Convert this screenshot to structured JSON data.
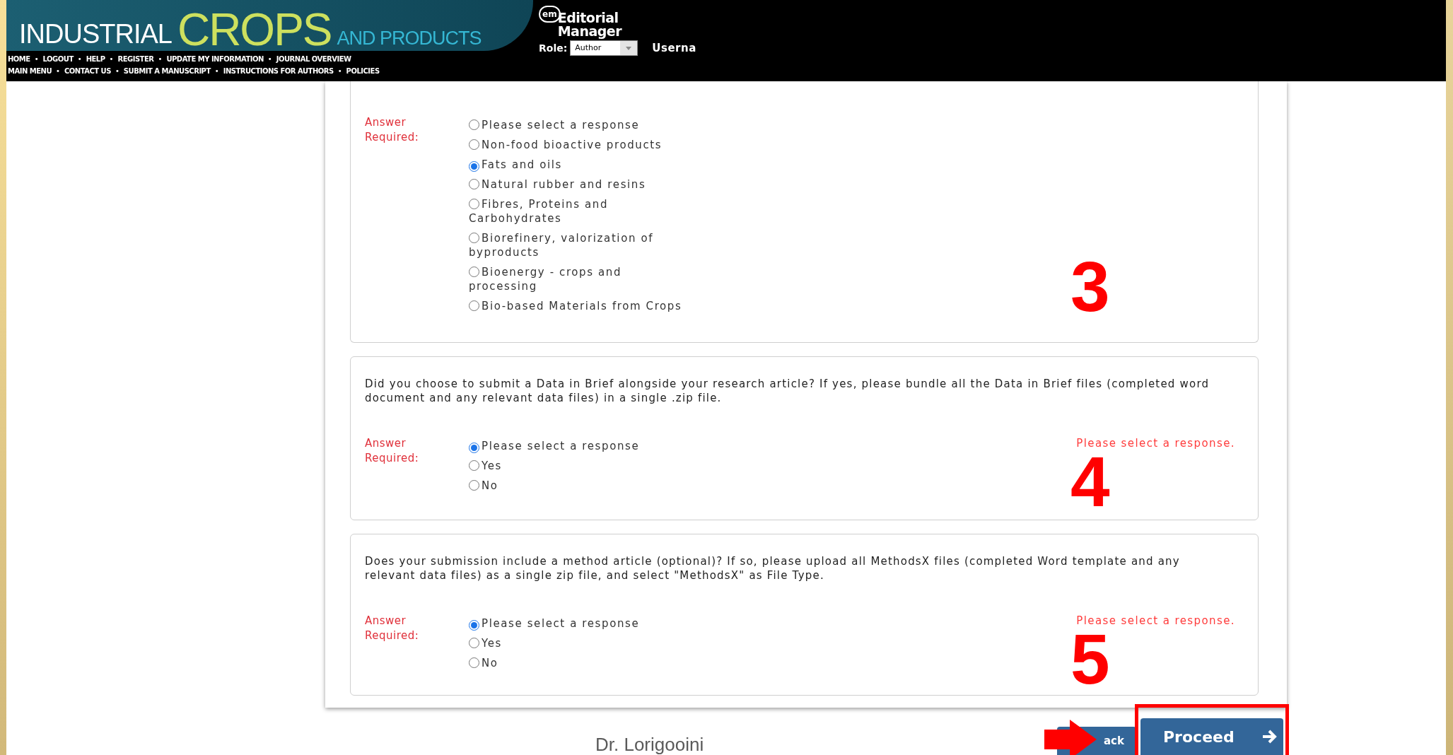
{
  "header": {
    "logo": {
      "word_1": "INDUSTRIAL",
      "word_2": "CROPS",
      "word_3": "AND PRODUCTS"
    },
    "nav": {
      "separator": "•",
      "top_line": [
        "HOME",
        "LOGOUT",
        "HELP",
        "REGISTER",
        "UPDATE MY INFORMATION",
        "JOURNAL OVERVIEW"
      ],
      "bottom_line": [
        "MAIN MENU",
        "CONTACT US",
        "SUBMIT A MANUSCRIPT",
        "INSTRUCTIONS FOR AUTHORS",
        "POLICIES"
      ]
    },
    "em_logo": {
      "badge": "em",
      "line_1": "Editorial",
      "line_2": "Manager"
    },
    "role": {
      "label": "Role:",
      "value": "Author"
    },
    "username_label": "Userna"
  },
  "questions": [
    {
      "answer_label": "Answer Required:",
      "annotation": "3",
      "options": [
        {
          "label": "Please select a response",
          "selected": false
        },
        {
          "label": "Non-food bioactive products",
          "selected": false
        },
        {
          "label": "Fats and oils",
          "selected": true
        },
        {
          "label": "Natural rubber and resins",
          "selected": false
        },
        {
          "label": "Fibres, Proteins and Carbohydrates",
          "selected": false
        },
        {
          "label": "Biorefinery, valorization of byproducts",
          "selected": false
        },
        {
          "label": "Bioenergy - crops and processing",
          "selected": false
        },
        {
          "label": "Bio-based Materials from Crops",
          "selected": false
        }
      ]
    },
    {
      "question": "Did you choose to submit a Data in Brief alongside your research article? If yes, please bundle all the Data in Brief files (completed word document and any relevant data files) in a single .zip file.",
      "answer_label": "Answer Required:",
      "error": "Please select a response.",
      "annotation": "4",
      "options": [
        {
          "label": "Please select a response",
          "selected": true
        },
        {
          "label": "Yes",
          "selected": false
        },
        {
          "label": "No",
          "selected": false
        }
      ]
    },
    {
      "question": "Does your submission include a method article (optional)? If so, please upload all MethodsX files (completed Word template and any relevant data files) as a single zip file, and select \"MethodsX\" as File Type.",
      "answer_label": "Answer Required:",
      "error": "Please select a response.",
      "annotation": "5",
      "options": [
        {
          "label": "Please select a response",
          "selected": true
        },
        {
          "label": "Yes",
          "selected": false
        },
        {
          "label": "No",
          "selected": false
        }
      ]
    }
  ],
  "buttons": [
    {
      "kind": "back",
      "label": "ack"
    },
    {
      "kind": "proceed",
      "label": "Proceed"
    }
  ],
  "footer": "Dr. Lorigooini"
}
